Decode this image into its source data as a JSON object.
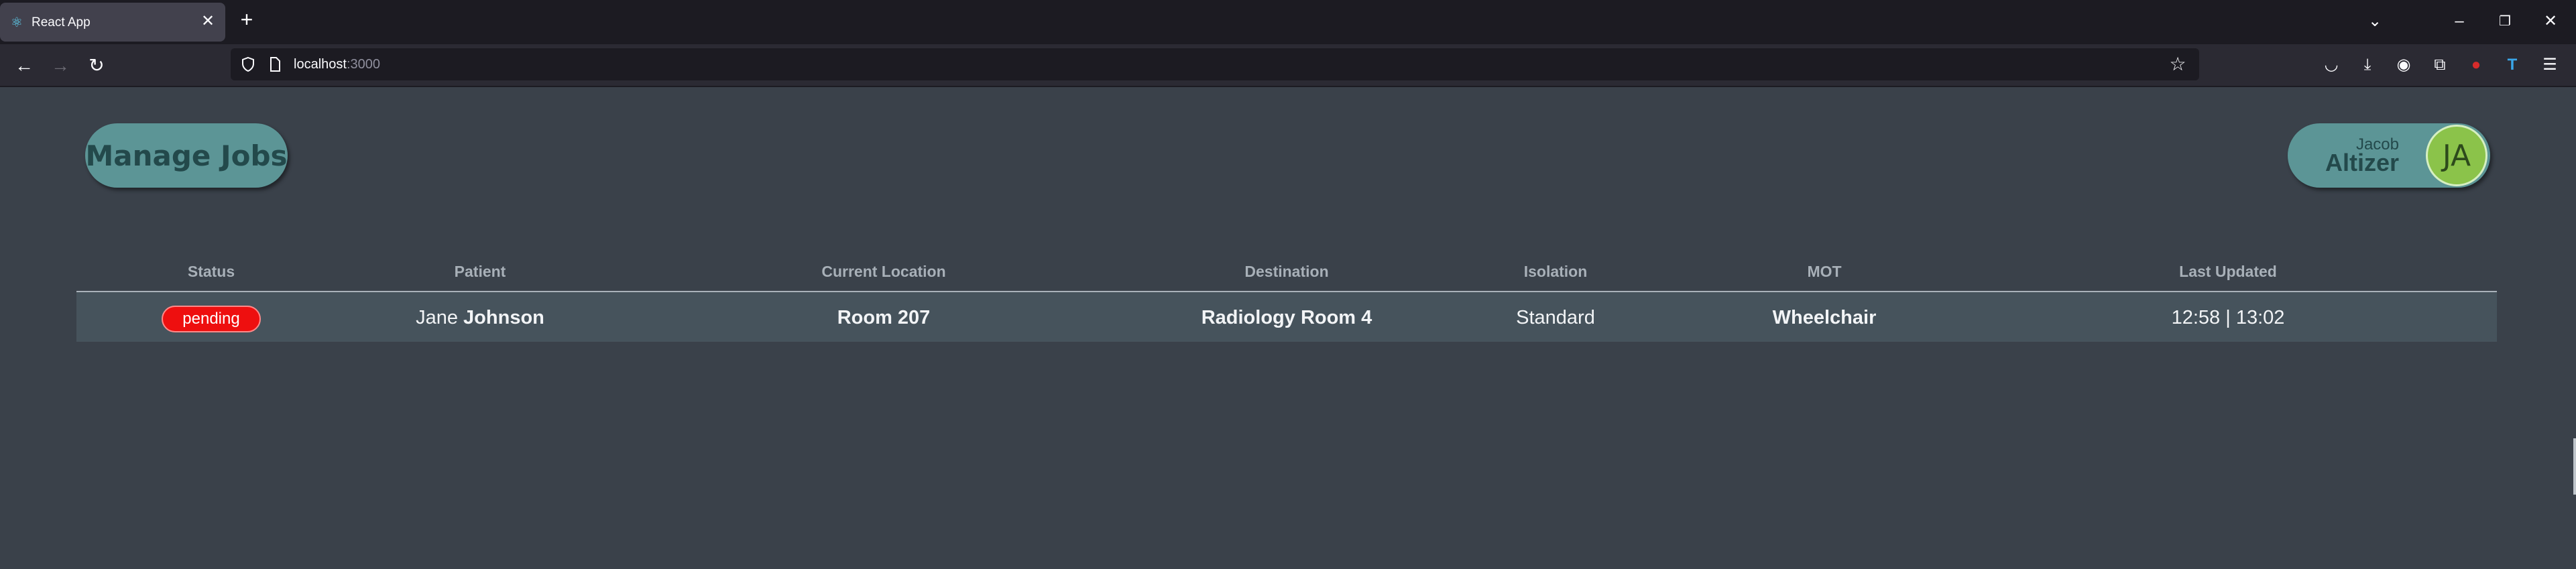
{
  "browser": {
    "tab_title": "React App",
    "url_host": "localhost",
    "url_port": ":3000"
  },
  "header": {
    "manage_jobs_label": "Manage Jobs",
    "user_first_name": "Jacob",
    "user_last_name": "Altizer",
    "user_initials": "JA"
  },
  "table": {
    "columns": [
      "Status",
      "Patient",
      "Current Location",
      "Destination",
      "Isolation",
      "MOT",
      "Last Updated"
    ],
    "rows": [
      {
        "status": "pending",
        "patient_first": "Jane",
        "patient_last": "Johnson",
        "current_location": "Room 207",
        "destination": "Radiology Room 4",
        "isolation": "Standard",
        "mot": "Wheelchair",
        "last_updated": "12:58 | 13:02"
      }
    ]
  },
  "colors": {
    "page_background": "#3a414a",
    "pill_background": "#5c9596",
    "avatar_background": "#8bc34a",
    "status_pending": "#ee0f0f",
    "row_background": "#46535c"
  }
}
